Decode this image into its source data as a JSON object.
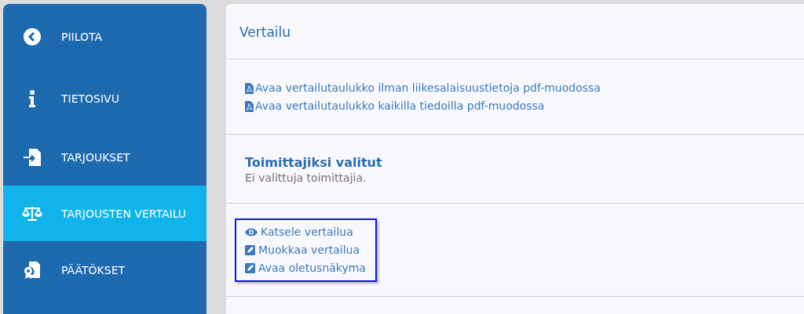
{
  "sidebar": {
    "items": [
      {
        "label": "PIILOTA",
        "selected": false
      },
      {
        "label": "TIETOSIVU",
        "selected": false
      },
      {
        "label": "TARJOUKSET",
        "selected": false
      },
      {
        "label": "TARJOUSTEN VERTAILU",
        "selected": true
      },
      {
        "label": "PÄÄTÖKSET",
        "selected": false
      }
    ]
  },
  "panel": {
    "title": "Vertailu",
    "pdf_links": [
      "Avaa vertailutaulukko ilman liikesalaisuustietoja pdf-muodossa",
      "Avaa vertailutaulukko kaikilla tiedoilla pdf-muodossa"
    ],
    "suppliers": {
      "heading": "Toimittajiksi valitut",
      "text": "Ei valittuja toimittajia."
    },
    "actions": [
      "Katsele vertailua",
      "Muokkaa vertailua",
      "Avaa oletusnäkyma"
    ]
  }
}
